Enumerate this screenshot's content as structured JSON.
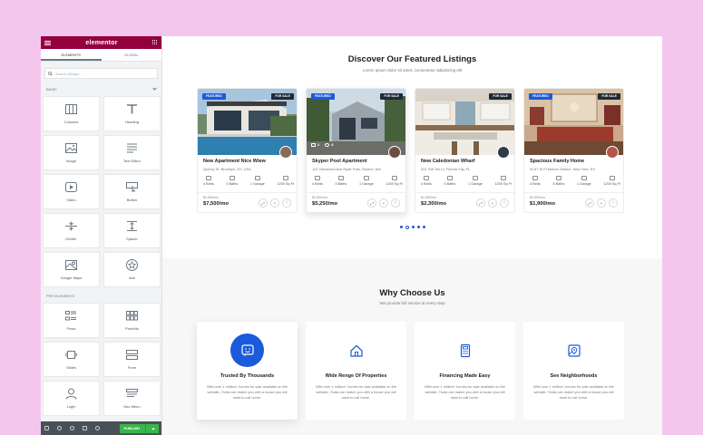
{
  "panel": {
    "brand": "elementor",
    "tabs": [
      "ELEMENTS",
      "GLOBAL"
    ],
    "search_placeholder": "Search Widget...",
    "basic_title": "BASIC",
    "basic_widgets": [
      {
        "label": "Columns",
        "icon": "columns-icon"
      },
      {
        "label": "Heading",
        "icon": "heading-icon"
      },
      {
        "label": "Image",
        "icon": "image-icon"
      },
      {
        "label": "Text Editor",
        "icon": "text-editor-icon"
      },
      {
        "label": "Video",
        "icon": "video-icon"
      },
      {
        "label": "Button",
        "icon": "button-icon"
      },
      {
        "label": "Divider",
        "icon": "divider-icon"
      },
      {
        "label": "Spacer",
        "icon": "spacer-icon"
      },
      {
        "label": "Google Maps",
        "icon": "google-maps-icon"
      },
      {
        "label": "Icon",
        "icon": "star-icon"
      }
    ],
    "pro_title": "PRO ELEMENTS",
    "pro_widgets": [
      {
        "label": "Posts",
        "icon": "posts-icon"
      },
      {
        "label": "Portfolio",
        "icon": "portfolio-icon"
      },
      {
        "label": "Slides",
        "icon": "slides-icon"
      },
      {
        "label": "Form",
        "icon": "form-icon"
      },
      {
        "label": "Login",
        "icon": "login-icon"
      },
      {
        "label": "Nav Menu",
        "icon": "nav-menu-icon"
      }
    ],
    "publish_label": "PUBLISH",
    "colors": {
      "brand": "#93003c",
      "publish": "#39b54a",
      "footer": "#495157"
    }
  },
  "featured": {
    "title": "Discover Our Featured Listings",
    "subtitle": "Lorem ipsum dolor sit amet, consectetur adipisicing elit",
    "listings": [
      {
        "badge_left": "FEATURED",
        "badge_right": "FOR SALE",
        "title": "New Apartment Nice Wiew",
        "address": "Quincy St, Brooklyn, NY, USA",
        "beds": "4 Beds",
        "baths": "5 Baths",
        "garage": "1 Garage",
        "area": "1200 Sq Ft",
        "old_price": "$2,800/mo",
        "price": "$7,500/mo",
        "overlay": [
          "",
          ""
        ]
      },
      {
        "badge_left": "FEATURED",
        "badge_right": "FOR SALE",
        "title": "Skyper Pool Apartment",
        "address": "112 Glenwood Ave Hyde Park, Boston, MA",
        "beds": "4 Beds",
        "baths": "5 Baths",
        "garage": "1 Garage",
        "area": "1200 Sq Ft",
        "old_price": "$2,800/mo",
        "price": "$5,250/mo",
        "overlay": [
          "2",
          "8"
        ]
      },
      {
        "badge_left": "",
        "badge_right": "FOR SALE",
        "title": "New Caledonian Wharf",
        "address": "201 SW 4th Ln Florida City, FL",
        "beds": "4 Beds",
        "baths": "5 Baths",
        "garage": "1 Garage",
        "area": "1200 Sq Ft",
        "old_price": "$2,800/mo",
        "price": "$2,300/mo",
        "overlay": [
          "",
          ""
        ]
      },
      {
        "badge_left": "FEATURED",
        "badge_right": "FOR SALE",
        "title": "Spacious Family Home",
        "address": "W 67 St Fl Marion District, New York, NY",
        "beds": "4 Beds",
        "baths": "5 Baths",
        "garage": "1 Garage",
        "area": "1200 Sq Ft",
        "old_price": "$2,800/mo",
        "price": "$1,900/mo",
        "overlay": [
          "",
          ""
        ]
      }
    ],
    "colors": {
      "accent": "#1a5adb",
      "dark_badge": "#1f2a36"
    }
  },
  "why": {
    "title": "Why Choose Us",
    "subtitle": "We provide full service at every step",
    "items": [
      {
        "title": "Trusted By Thousands",
        "desc": "With over 1 million+ homes for sale available on the website, Trulia can match you with a house you will want to call home.",
        "icon": "smiley-chat-icon"
      },
      {
        "title": "Wide Renge Of Properties",
        "desc": "With over 1 million+ homes for sale available on the website, Trulia can match you with a house you will want to call home.",
        "icon": "house-icon"
      },
      {
        "title": "Financing Made Easy",
        "desc": "With over 1 million+ homes for sale available on the website, Trulia can match you with a house you will want to call home.",
        "icon": "calculator-icon"
      },
      {
        "title": "See Neighborhoods",
        "desc": "With over 1 million+ homes for sale available on the website, Trulia can match you with a house you will want to call home.",
        "icon": "map-pin-icon"
      }
    ]
  }
}
